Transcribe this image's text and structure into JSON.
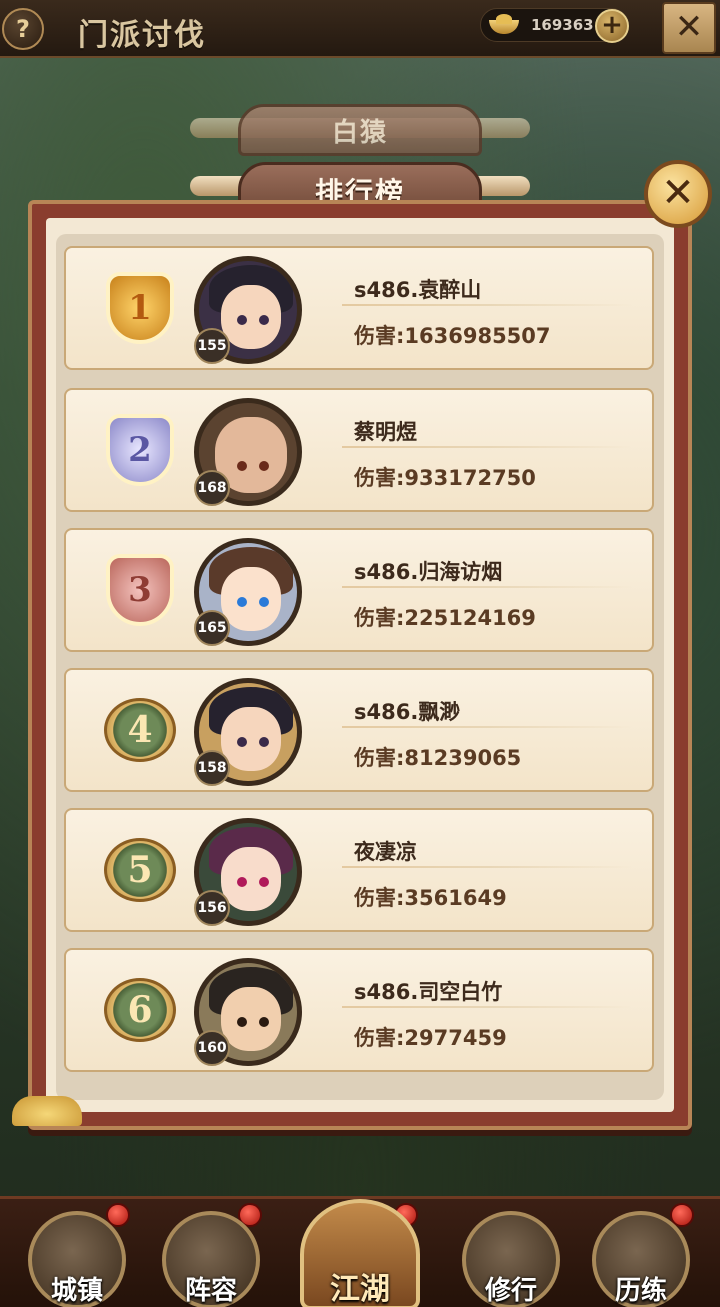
{
  "header": {
    "help_symbol": "?",
    "title": "门派讨伐",
    "currency_value": "169363",
    "plus_symbol": "+",
    "close_symbol": "✕"
  },
  "tabs": {
    "boss_tab": "白猿",
    "ranking_tab": "排行榜"
  },
  "panel": {
    "close_symbol": "✕"
  },
  "ranking": [
    {
      "rank": "1",
      "level": "155",
      "name": "s486.袁醉山",
      "damage": "伤害:1636985507"
    },
    {
      "rank": "2",
      "level": "168",
      "name": "蔡明煜",
      "damage": "伤害:933172750"
    },
    {
      "rank": "3",
      "level": "165",
      "name": "s486.归海访烟",
      "damage": "伤害:225124169"
    },
    {
      "rank": "4",
      "level": "158",
      "name": "s486.飘渺",
      "damage": "伤害:81239065"
    },
    {
      "rank": "5",
      "level": "156",
      "name": "夜凄凉",
      "damage": "伤害:3561649"
    },
    {
      "rank": "6",
      "level": "160",
      "name": "s486.司空白竹",
      "damage": "伤害:2977459"
    }
  ],
  "bottom_nav": {
    "town": "城镇",
    "lineup": "阵容",
    "jianghu": "江湖",
    "cultivation": "修行",
    "training": "历练"
  },
  "colors": {
    "panel_border": "#8a3d2e",
    "row_background": "#faf1e1",
    "text_dark": "#3d2a1c"
  }
}
